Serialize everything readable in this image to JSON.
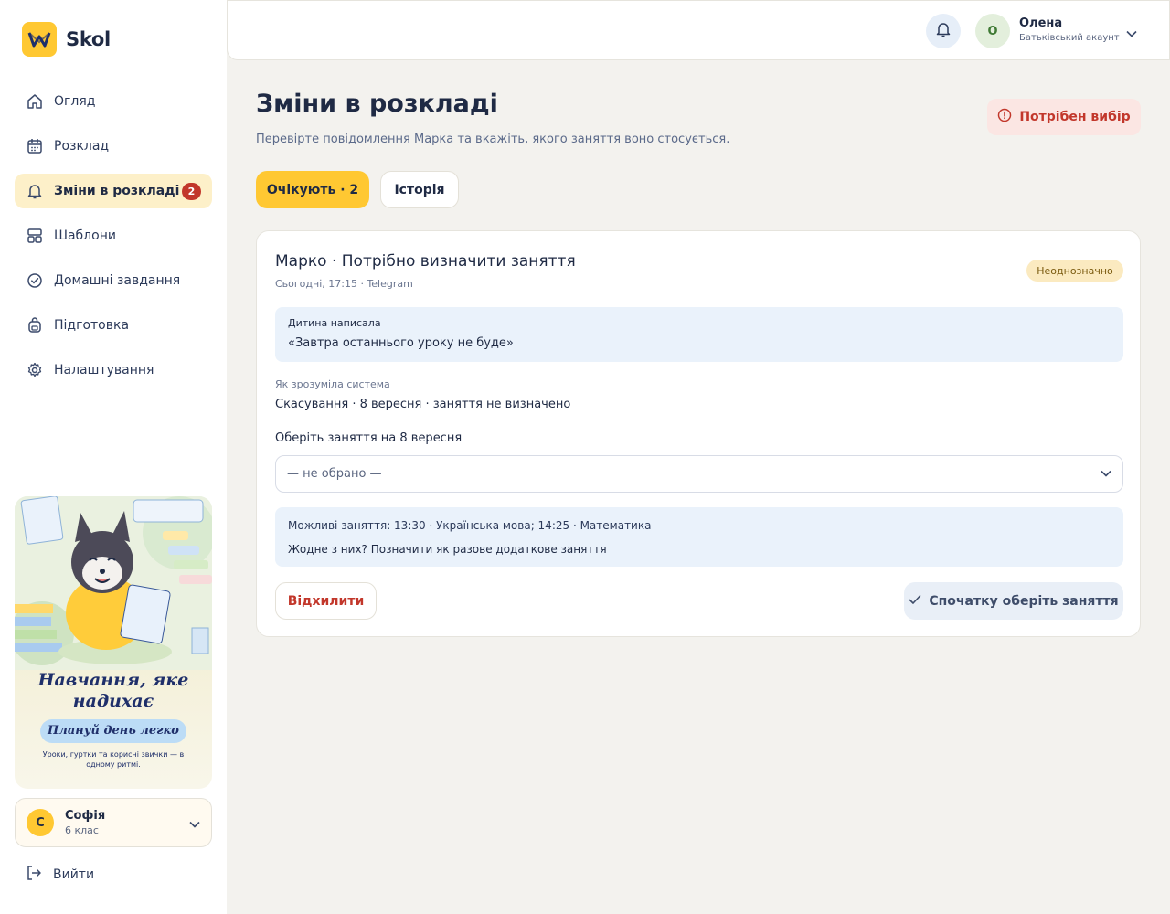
{
  "app": {
    "name": "Skol"
  },
  "sidebar": {
    "items": [
      {
        "label": "Огляд",
        "icon": "home-icon"
      },
      {
        "label": "Розклад",
        "icon": "calendar-icon"
      },
      {
        "label": "Зміни в розкладі",
        "icon": "bell-icon",
        "badge": "2",
        "active": true
      },
      {
        "label": "Шаблони",
        "icon": "templates-icon"
      },
      {
        "label": "Домашні завдання",
        "icon": "check-circle-icon"
      },
      {
        "label": "Підготовка",
        "icon": "backpack-icon"
      },
      {
        "label": "Налаштування",
        "icon": "gear-icon"
      }
    ],
    "promo": {
      "title": "Навчання, яке надихає",
      "pill": "Плануй день легко",
      "subtitle": "Уроки, гуртки та корисні звички — в одному ритмі."
    },
    "profile": {
      "initial": "С",
      "name": "Софія",
      "grade": "6 клас"
    },
    "logout": "Вийти"
  },
  "header": {
    "user": {
      "initial": "О",
      "name": "Олена",
      "role": "Батьківський акаунт"
    }
  },
  "main": {
    "title": "Зміни в розкладі",
    "subtitle": "Перевірте повідомлення Марка та вкажіть, якого заняття воно стосується.",
    "status_button": "Потрібен вибір",
    "tabs": {
      "pending": "Очікують · 2",
      "history": "Історія"
    },
    "card": {
      "title": "Марко · Потрібно визначити заняття",
      "meta": "Сьогодні, 17:15 · Telegram",
      "badge": "Неоднозначно",
      "message_label": "Дитина написала",
      "message_text": "«Завтра останнього уроку не буде»",
      "system_label": "Як зрозуміла система",
      "system_text": "Скасування · 8 вересня · заняття не визначено",
      "select_label": "Оберіть заняття на 8 вересня",
      "select_value": "— не обрано —",
      "options_text": "Можливі заняття: 13:30 · Українська мова; 14:25 · Математика",
      "options_link": "Жодне з них? Позначити як разове додаткове заняття",
      "reject_button": "Відхилити",
      "confirm_button": "Спочатку оберіть заняття"
    }
  },
  "colors": {
    "accent": "#ffc832",
    "danger": "#c2372b",
    "background": "#f3f2ee"
  }
}
